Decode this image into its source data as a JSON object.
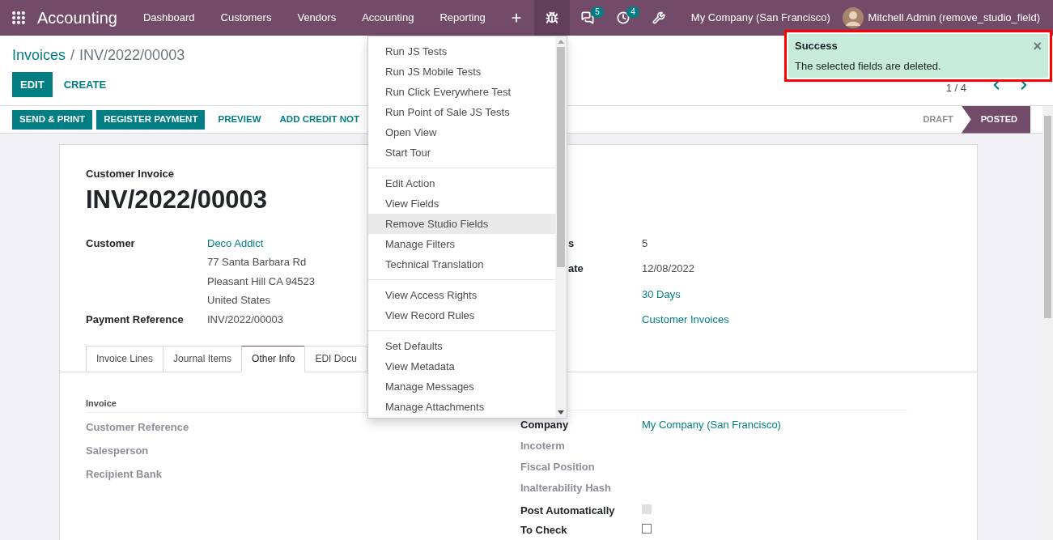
{
  "navbar": {
    "app_name": "Accounting",
    "menu": [
      "Dashboard",
      "Customers",
      "Vendors",
      "Accounting",
      "Reporting"
    ],
    "indicators": [
      {
        "kind": "add",
        "active": false
      },
      {
        "kind": "debug",
        "active": true
      },
      {
        "kind": "messages",
        "active": false,
        "badge": "5"
      },
      {
        "kind": "activities",
        "active": false,
        "badge": "4"
      },
      {
        "kind": "tools",
        "active": false
      }
    ],
    "company": "My Company (San Francisco)",
    "user": "Mitchell Admin (remove_studio_field)"
  },
  "breadcrumb": {
    "items": [
      {
        "label": "Invoices",
        "link": true
      },
      {
        "label": "INV/2022/00003",
        "link": false
      }
    ],
    "separator": "/"
  },
  "actions": [
    {
      "label": "EDIT",
      "primary": true
    },
    {
      "label": "CREATE",
      "primary": false
    }
  ],
  "pager": "1 / 4",
  "status_actions": [
    {
      "label": "SEND & PRINT",
      "primary": true
    },
    {
      "label": "REGISTER PAYMENT",
      "primary": true
    },
    {
      "label": "PREVIEW",
      "primary": false
    },
    {
      "label": "ADD CREDIT NOT",
      "primary": false
    }
  ],
  "stages": [
    {
      "label": "DRAFT",
      "selected": false
    },
    {
      "label": "POSTED",
      "selected": true
    }
  ],
  "sheet": {
    "subtitle": "Customer Invoice",
    "title": "INV/2022/00003",
    "left_fields": [
      {
        "label": "Customer",
        "lines": [
          {
            "text": "Deco Addict",
            "link": true
          },
          {
            "text": "77 Santa Barbara Rd",
            "link": false
          },
          {
            "text": "Pleasant Hill CA 94523",
            "link": false
          },
          {
            "text": "United States",
            "link": false
          }
        ]
      },
      {
        "label": "Payment Reference",
        "lines": [
          {
            "text": "INV/2022/00003",
            "link": false
          }
        ]
      }
    ],
    "right_fields": [
      {
        "label": "s",
        "lines": [
          {
            "text": "5",
            "link": false
          }
        ]
      },
      {
        "label": "ate",
        "lines": [
          {
            "text": "12/08/2022",
            "link": false
          }
        ]
      },
      {
        "lines": [
          {
            "text": "30 Days",
            "link": true
          }
        ]
      },
      {
        "lines": [
          {
            "text": "Customer Invoices",
            "link": true
          }
        ]
      }
    ],
    "tabs": [
      {
        "label": "Invoice Lines",
        "selected": false
      },
      {
        "label": "Journal Items",
        "selected": false
      },
      {
        "label": "Other Info",
        "selected": true
      },
      {
        "label": "EDI Docu",
        "selected": false
      }
    ],
    "other_info": {
      "left_heading": "Invoice",
      "left_fields": [
        {
          "label": "Customer Reference",
          "muted": true
        },
        {
          "label": "Salesperson",
          "muted": true
        },
        {
          "label": "Recipient Bank",
          "muted": true
        }
      ],
      "right_fields": [
        {
          "kind": "text",
          "label": "Company",
          "muted": false,
          "value": "My Company (San Francisco)",
          "link": true
        },
        {
          "kind": "text",
          "label": "Incoterm",
          "muted": true
        },
        {
          "kind": "text",
          "label": "Fiscal Position",
          "muted": true
        },
        {
          "kind": "text",
          "label": "Inalterability Hash",
          "muted": true
        },
        {
          "kind": "checkbox",
          "label": "Post Automatically",
          "muted": false,
          "checked": false,
          "disabled": true
        },
        {
          "kind": "checkbox",
          "label": "To Check",
          "muted": false,
          "checked": false,
          "disabled": false
        }
      ]
    }
  },
  "debug_menu": {
    "groups": [
      [
        {
          "label": "Run JS Tests",
          "selected": false
        },
        {
          "label": "Run JS Mobile Tests",
          "selected": false
        },
        {
          "label": "Run Click Everywhere Test",
          "selected": false
        },
        {
          "label": "Run Point of Sale JS Tests",
          "selected": false
        },
        {
          "label": "Open View",
          "selected": false
        },
        {
          "label": "Start Tour",
          "selected": false
        }
      ],
      [
        {
          "label": "Edit Action",
          "selected": false
        },
        {
          "label": "View Fields",
          "selected": false
        },
        {
          "label": "Remove Studio Fields",
          "selected": true
        },
        {
          "label": "Manage Filters",
          "selected": false
        },
        {
          "label": "Technical Translation",
          "selected": false
        }
      ],
      [
        {
          "label": "View Access Rights",
          "selected": false
        },
        {
          "label": "View Record Rules",
          "selected": false
        }
      ],
      [
        {
          "label": "Set Defaults",
          "selected": false
        },
        {
          "label": "View Metadata",
          "selected": false
        },
        {
          "label": "Manage Messages",
          "selected": false
        },
        {
          "label": "Manage Attachments",
          "selected": false
        }
      ]
    ]
  },
  "notification": {
    "title": "Success",
    "message": "The selected fields are deleted.",
    "close": "×",
    "highlighted": true
  }
}
